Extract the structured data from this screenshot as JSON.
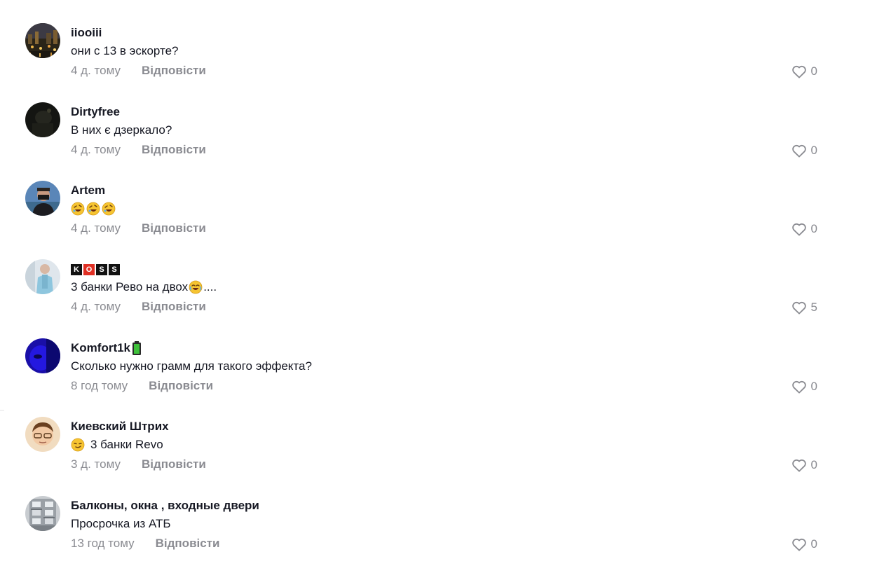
{
  "comments": [
    {
      "username": "iiooiii",
      "text": "они с 13 в эскорте?",
      "time": "4 д. тому",
      "reply_label": "Відповісти",
      "likes": "0",
      "avatar_icon": "city-night-photo"
    },
    {
      "username": "Dirtyfree",
      "text": "В них є дзеркало?",
      "time": "4 д. тому",
      "reply_label": "Відповісти",
      "likes": "0",
      "avatar_icon": "dark-photo"
    },
    {
      "username": "Artem",
      "text": "🤣🤣🤣",
      "time": "4 д. тому",
      "reply_label": "Відповісти",
      "likes": "0",
      "avatar_icon": "man-masked-photo"
    },
    {
      "username": "KOSS",
      "username_letters": [
        "K",
        "O",
        "S",
        "S"
      ],
      "text": "3 банки Рево на двох",
      "text_suffix": "....",
      "time": "4 д. тому",
      "reply_label": "Відповісти",
      "likes": "5",
      "avatar_icon": "person-light-photo"
    },
    {
      "username": "Komfort1k",
      "text": "Сколько нужно грамм для такого эффекта?",
      "time": "8 год тому",
      "reply_label": "Відповісти",
      "likes": "0",
      "avatar_icon": "blue-face-photo"
    },
    {
      "username": "Киевский Штрих",
      "text": "3 банки Revo",
      "time": "3 д. тому",
      "reply_label": "Відповісти",
      "likes": "0",
      "avatar_icon": "man-glasses-photo"
    },
    {
      "username": "Балконы, окна , входные двери",
      "text": "Просрочка из АТБ",
      "time": "13 год тому",
      "reply_label": "Відповісти",
      "likes": "0",
      "avatar_icon": "building-photo"
    }
  ],
  "colors": {
    "primary_text": "#161823",
    "secondary_text": "#8a8b91",
    "badge_red": "#e03024"
  }
}
